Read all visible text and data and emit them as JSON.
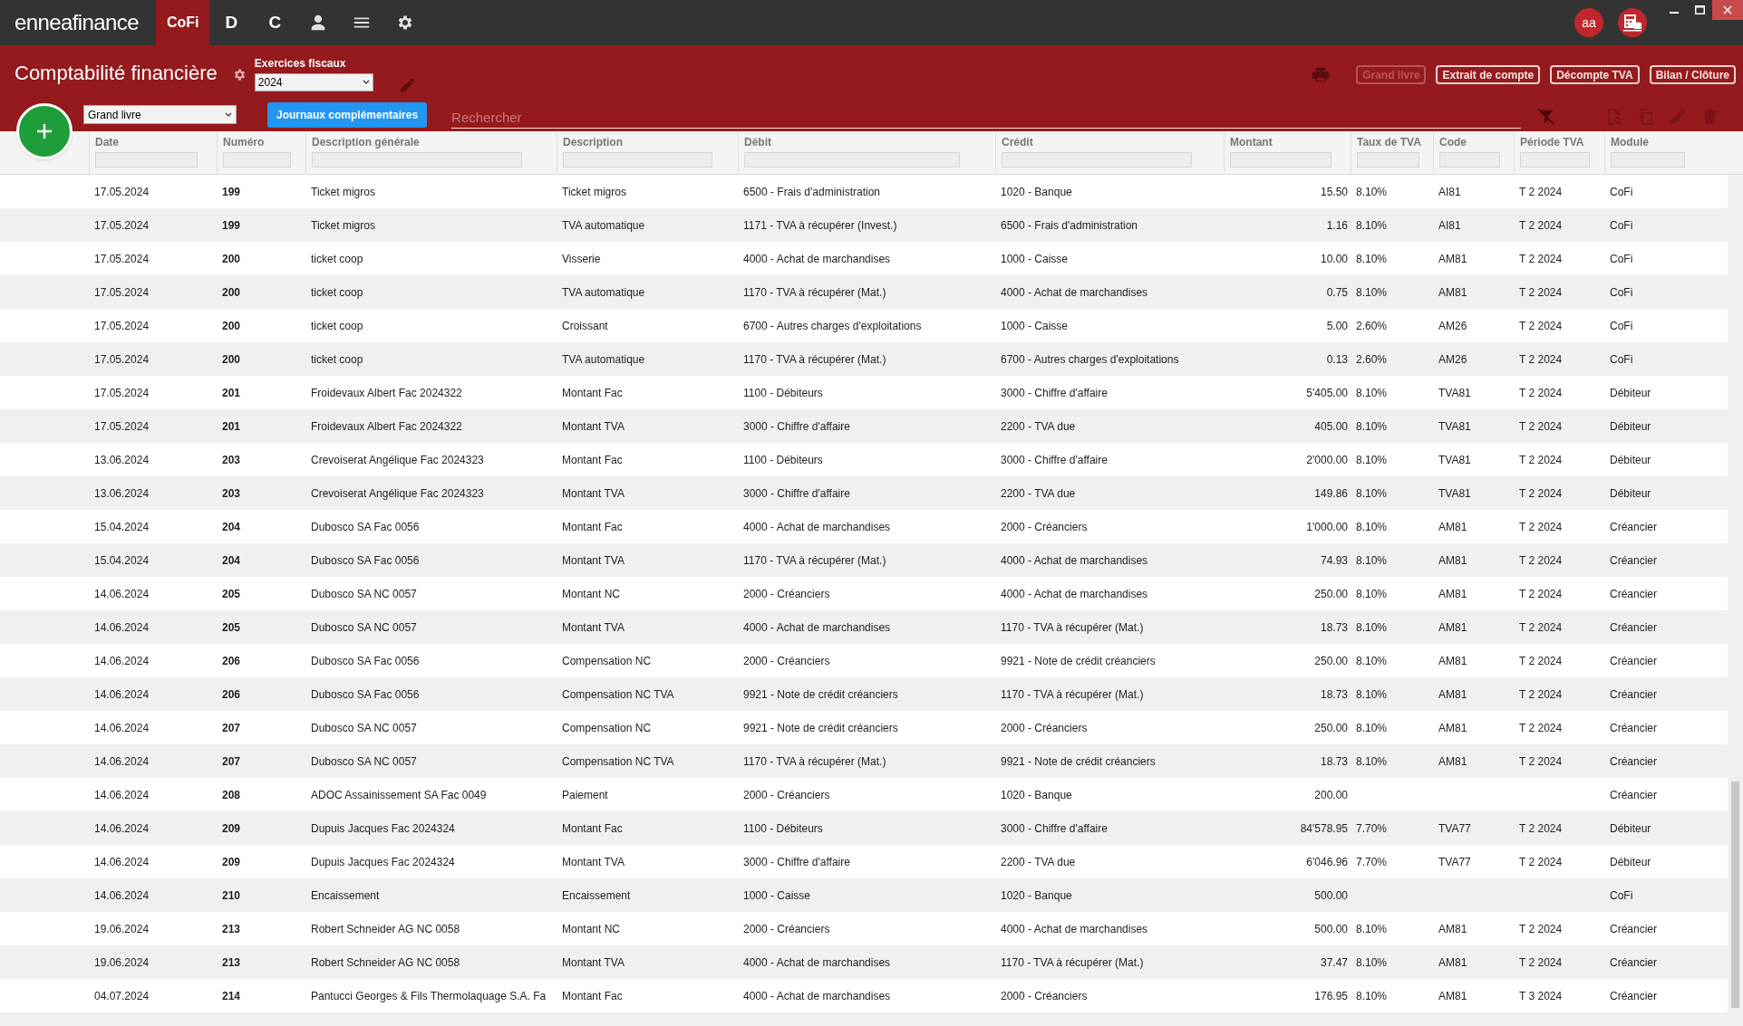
{
  "app": {
    "logo": "enneafinance",
    "nav": [
      {
        "kind": "text",
        "label": "CoFi",
        "selected": true
      },
      {
        "kind": "text",
        "label": "D",
        "selected": false
      },
      {
        "kind": "text",
        "label": "C",
        "selected": false
      },
      {
        "kind": "user",
        "selected": false
      },
      {
        "kind": "menu",
        "selected": false
      },
      {
        "kind": "settings",
        "selected": false
      }
    ],
    "avatar": "aa"
  },
  "header": {
    "title": "Comptabilité financière",
    "fiscal_year": {
      "label": "Exercices fiscaux",
      "value": "2024"
    },
    "report_buttons": [
      {
        "label": "Grand livre",
        "disabled": true
      },
      {
        "label": "Extrait de compte",
        "disabled": false
      },
      {
        "label": "Décompte TVA",
        "disabled": false
      },
      {
        "label": "Bilan / Clôture",
        "disabled": false
      }
    ],
    "view_select": {
      "value": "Grand livre"
    },
    "journals_button": "Journaux complémentaires",
    "search": {
      "placeholder": "Rechercher"
    },
    "actions": [
      {
        "kind": "view",
        "disabled": true
      },
      {
        "kind": "copy",
        "disabled": true
      },
      {
        "kind": "edit",
        "disabled": true
      },
      {
        "kind": "delete",
        "disabled": true
      }
    ]
  },
  "table": {
    "columns": [
      "Date",
      "Numéro",
      "Description générale",
      "Description",
      "Débit",
      "Crédit",
      "Montant",
      "Taux de TVA",
      "Code",
      "Période TVA",
      "Module"
    ],
    "rows": [
      {
        "date": "17.05.2024",
        "number": "199",
        "general_description": "Ticket migros",
        "description": "Ticket migros",
        "debit": "6500 - Frais d'administration",
        "credit": "1020 - Banque",
        "amount": "15.50",
        "vat_rate": "8.10%",
        "code": "AI81",
        "vat_period": "T 2 2024",
        "module": "CoFi"
      },
      {
        "date": "17.05.2024",
        "number": "199",
        "general_description": "Ticket migros",
        "description": "TVA automatique",
        "debit": "1171 - TVA à récupérer (Invest.)",
        "credit": "6500 - Frais d'administration",
        "amount": "1.16",
        "vat_rate": "8.10%",
        "code": "AI81",
        "vat_period": "T 2 2024",
        "module": "CoFi"
      },
      {
        "date": "17.05.2024",
        "number": "200",
        "general_description": "ticket coop",
        "description": "Visserie",
        "debit": "4000 - Achat de marchandises",
        "credit": "1000 - Caisse",
        "amount": "10.00",
        "vat_rate": "8.10%",
        "code": "AM81",
        "vat_period": "T 2 2024",
        "module": "CoFi"
      },
      {
        "date": "17.05.2024",
        "number": "200",
        "general_description": "ticket coop",
        "description": "TVA automatique",
        "debit": "1170 - TVA à récupérer (Mat.)",
        "credit": "4000 - Achat de marchandises",
        "amount": "0.75",
        "vat_rate": "8.10%",
        "code": "AM81",
        "vat_period": "T 2 2024",
        "module": "CoFi"
      },
      {
        "date": "17.05.2024",
        "number": "200",
        "general_description": "ticket coop",
        "description": "Croissant",
        "debit": "6700 - Autres charges d'exploitations",
        "credit": "1000 - Caisse",
        "amount": "5.00",
        "vat_rate": "2.60%",
        "code": "AM26",
        "vat_period": "T 2 2024",
        "module": "CoFi"
      },
      {
        "date": "17.05.2024",
        "number": "200",
        "general_description": "ticket coop",
        "description": "TVA automatique",
        "debit": "1170 - TVA à récupérer (Mat.)",
        "credit": "6700 - Autres charges d'exploitations",
        "amount": "0.13",
        "vat_rate": "2.60%",
        "code": "AM26",
        "vat_period": "T 2 2024",
        "module": "CoFi"
      },
      {
        "date": "17.05.2024",
        "number": "201",
        "general_description": "Froidevaux Albert Fac 2024322",
        "description": "Montant Fac",
        "debit": "1100 - Débiteurs",
        "credit": "3000 - Chiffre d'affaire",
        "amount": "5'405.00",
        "vat_rate": "8.10%",
        "code": "TVA81",
        "vat_period": "T 2 2024",
        "module": "Débiteur"
      },
      {
        "date": "17.05.2024",
        "number": "201",
        "general_description": "Froidevaux Albert Fac 2024322",
        "description": "Montant TVA",
        "debit": "3000 - Chiffre d'affaire",
        "credit": "2200 - TVA due",
        "amount": "405.00",
        "vat_rate": "8.10%",
        "code": "TVA81",
        "vat_period": "T 2 2024",
        "module": "Débiteur"
      },
      {
        "date": "13.06.2024",
        "number": "203",
        "general_description": "Crevoiserat Angélique Fac 2024323",
        "description": "Montant Fac",
        "debit": "1100 - Débiteurs",
        "credit": "3000 - Chiffre d'affaire",
        "amount": "2'000.00",
        "vat_rate": "8.10%",
        "code": "TVA81",
        "vat_period": "T 2 2024",
        "module": "Débiteur"
      },
      {
        "date": "13.06.2024",
        "number": "203",
        "general_description": "Crevoiserat Angélique Fac 2024323",
        "description": "Montant TVA",
        "debit": "3000 - Chiffre d'affaire",
        "credit": "2200 - TVA due",
        "amount": "149.86",
        "vat_rate": "8.10%",
        "code": "TVA81",
        "vat_period": "T 2 2024",
        "module": "Débiteur"
      },
      {
        "date": "15.04.2024",
        "number": "204",
        "general_description": "Dubosco SA Fac 0056",
        "description": "Montant Fac",
        "debit": "4000 - Achat de marchandises",
        "credit": "2000 - Créanciers",
        "amount": "1'000.00",
        "vat_rate": "8.10%",
        "code": "AM81",
        "vat_period": "T 2 2024",
        "module": "Créancier"
      },
      {
        "date": "15.04.2024",
        "number": "204",
        "general_description": "Dubosco SA Fac 0056",
        "description": "Montant TVA",
        "debit": "1170 - TVA à récupérer (Mat.)",
        "credit": "4000 - Achat de marchandises",
        "amount": "74.93",
        "vat_rate": "8.10%",
        "code": "AM81",
        "vat_period": "T 2 2024",
        "module": "Créancier"
      },
      {
        "date": "14.06.2024",
        "number": "205",
        "general_description": "Dubosco SA NC 0057",
        "description": "Montant NC",
        "debit": "2000 - Créanciers",
        "credit": "4000 - Achat de marchandises",
        "amount": "250.00",
        "vat_rate": "8.10%",
        "code": "AM81",
        "vat_period": "T 2 2024",
        "module": "Créancier"
      },
      {
        "date": "14.06.2024",
        "number": "205",
        "general_description": "Dubosco SA NC 0057",
        "description": "Montant TVA",
        "debit": "4000 - Achat de marchandises",
        "credit": "1170 - TVA à récupérer (Mat.)",
        "amount": "18.73",
        "vat_rate": "8.10%",
        "code": "AM81",
        "vat_period": "T 2 2024",
        "module": "Créancier"
      },
      {
        "date": "14.06.2024",
        "number": "206",
        "general_description": "Dubosco SA Fac 0056",
        "description": "Compensation NC",
        "debit": "2000 - Créanciers",
        "credit": "9921 - Note de crédit créanciers",
        "amount": "250.00",
        "vat_rate": "8.10%",
        "code": "AM81",
        "vat_period": "T 2 2024",
        "module": "Créancier"
      },
      {
        "date": "14.06.2024",
        "number": "206",
        "general_description": "Dubosco SA Fac 0056",
        "description": "Compensation NC TVA",
        "debit": "9921 - Note de crédit créanciers",
        "credit": "1170 - TVA à récupérer (Mat.)",
        "amount": "18.73",
        "vat_rate": "8.10%",
        "code": "AM81",
        "vat_period": "T 2 2024",
        "module": "Créancier"
      },
      {
        "date": "14.06.2024",
        "number": "207",
        "general_description": "Dubosco SA NC 0057",
        "description": "Compensation NC",
        "debit": "9921 - Note de crédit créanciers",
        "credit": "2000 - Créanciers",
        "amount": "250.00",
        "vat_rate": "8.10%",
        "code": "AM81",
        "vat_period": "T 2 2024",
        "module": "Créancier"
      },
      {
        "date": "14.06.2024",
        "number": "207",
        "general_description": "Dubosco SA NC 0057",
        "description": "Compensation NC TVA",
        "debit": "1170 - TVA à récupérer (Mat.)",
        "credit": "9921 - Note de crédit créanciers",
        "amount": "18.73",
        "vat_rate": "8.10%",
        "code": "AM81",
        "vat_period": "T 2 2024",
        "module": "Créancier"
      },
      {
        "date": "14.06.2024",
        "number": "208",
        "general_description": "ADOC Assainissement SA Fac 0049",
        "description": "Paiement",
        "debit": "2000 - Créanciers",
        "credit": "1020 - Banque",
        "amount": "200.00",
        "module": "Créancier"
      },
      {
        "date": "14.06.2024",
        "number": "209",
        "general_description": "Dupuis Jacques Fac 2024324",
        "description": "Montant Fac",
        "debit": "1100 - Débiteurs",
        "credit": "3000 - Chiffre d'affaire",
        "amount": "84'578.95",
        "vat_rate": "7.70%",
        "code": "TVA77",
        "vat_period": "T 2 2024",
        "module": "Débiteur"
      },
      {
        "date": "14.06.2024",
        "number": "209",
        "general_description": "Dupuis Jacques Fac 2024324",
        "description": "Montant TVA",
        "debit": "3000 - Chiffre d'affaire",
        "credit": "2200 - TVA due",
        "amount": "6'046.96",
        "vat_rate": "7.70%",
        "code": "TVA77",
        "vat_period": "T 2 2024",
        "module": "Débiteur"
      },
      {
        "date": "14.06.2024",
        "number": "210",
        "general_description": "Encaissement",
        "description": "Encaissement",
        "debit": "1000 - Caisse",
        "credit": "1020 - Banque",
        "amount": "500.00",
        "module": "CoFi"
      },
      {
        "date": "19.06.2024",
        "number": "213",
        "general_description": "Robert Schneider AG NC 0058",
        "description": "Montant NC",
        "debit": "2000 - Créanciers",
        "credit": "4000 - Achat de marchandises",
        "amount": "500.00",
        "vat_rate": "8.10%",
        "code": "AM81",
        "vat_period": "T 2 2024",
        "module": "Créancier"
      },
      {
        "date": "19.06.2024",
        "number": "213",
        "general_description": "Robert Schneider AG NC 0058",
        "description": "Montant TVA",
        "debit": "4000 - Achat de marchandises",
        "credit": "1170 - TVA à récupérer (Mat.)",
        "amount": "37.47",
        "vat_rate": "8.10%",
        "code": "AM81",
        "vat_period": "T 2 2024",
        "module": "Créancier"
      },
      {
        "date": "04.07.2024",
        "number": "214",
        "general_description": "Pantucci Georges & Fils Thermolaquage S.A. Fa",
        "description": "Montant Fac",
        "debit": "4000 - Achat de marchandises",
        "credit": "2000 - Créanciers",
        "amount": "176.95",
        "vat_rate": "8.10%",
        "code": "AM81",
        "vat_period": "T 3 2024",
        "module": "Créancier"
      }
    ]
  }
}
